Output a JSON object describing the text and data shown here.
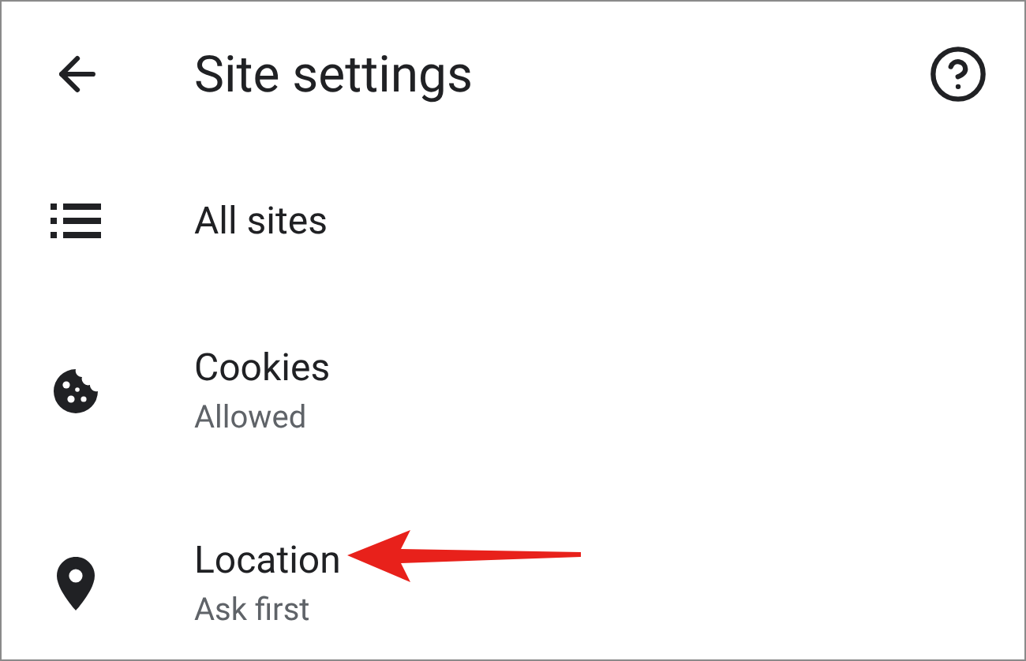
{
  "header": {
    "title": "Site settings"
  },
  "items": [
    {
      "kind": "list",
      "title": "All sites"
    },
    {
      "kind": "cookie",
      "title": "Cookies",
      "subtitle": "Allowed"
    },
    {
      "kind": "pin",
      "title": "Location",
      "subtitle": "Ask first",
      "pointed": true
    }
  ]
}
